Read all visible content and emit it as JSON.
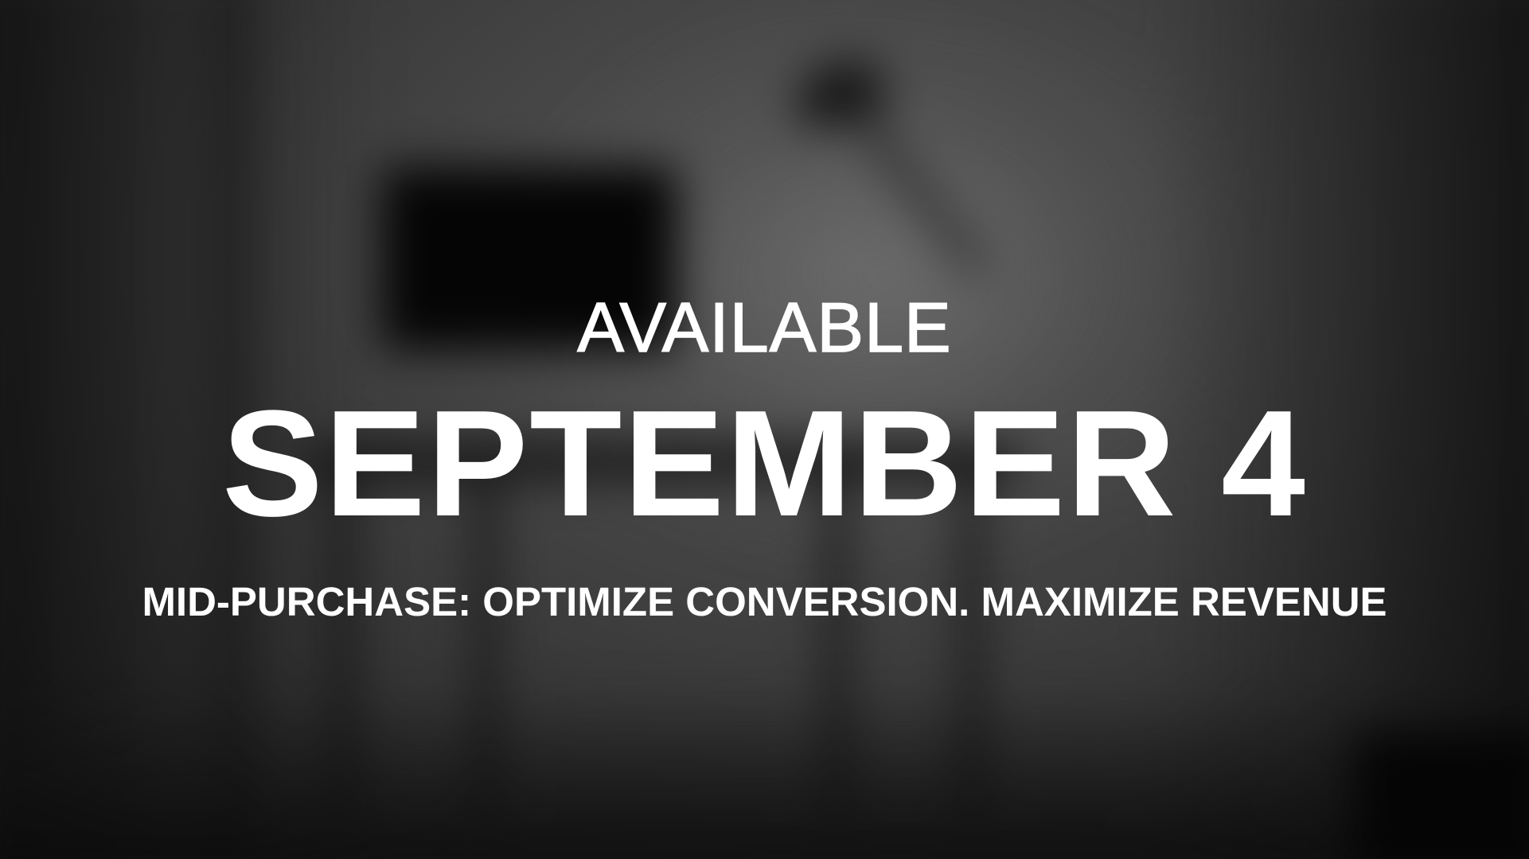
{
  "slide": {
    "kicker": "AVAILABLE",
    "headline": "SEPTEMBER 4",
    "tagline": "MID-PURCHASE: OPTIMIZE CONVERSION. MAXIMIZE REVENUE"
  },
  "colors": {
    "text": "#ffffff",
    "background": "#2b2b2b"
  }
}
